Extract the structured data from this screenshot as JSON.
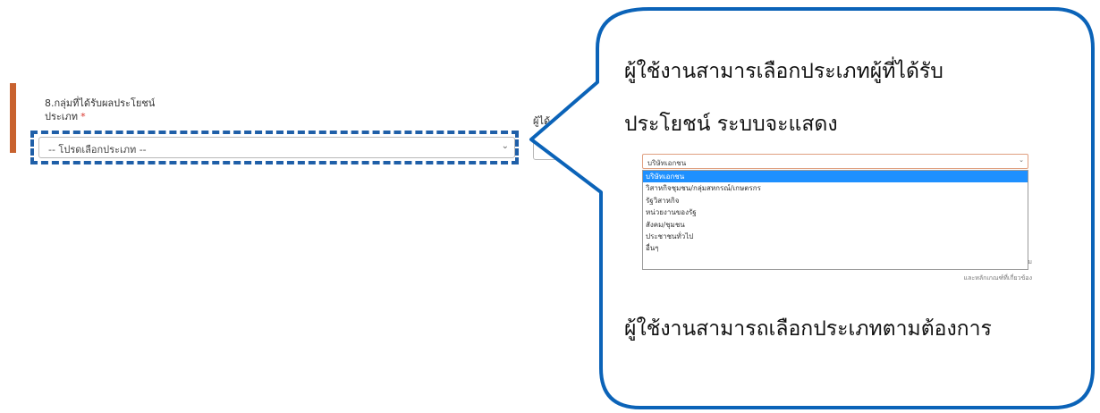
{
  "form": {
    "section_title": "8.กลุ่มที่ได้รับผลประโยชน์",
    "type_label": "ประเภท",
    "required_mark": "*",
    "select_placeholder": "-- โปรดเลือกประเภท --",
    "partial_label": "ผู้ได้"
  },
  "callout": {
    "line1": "ผู้ใช้งานสามารเลือกประเภทผู้ที่ได้รับ",
    "line2": "ประโยชน์ ระบบจะแสดง",
    "line3": "ผู้ใช้งานสามารถเลือกประเภทตามต้องการ"
  },
  "dropdown_preview": {
    "selected_value": "บริษัทเอกชน",
    "options": [
      "บริษัทเอกชน",
      "วิสาหกิจชุมชน/กลุ่มสหกรณ์/เกษตรกร",
      "รัฐวิสาหกิจ",
      "หน่วยงานของรัฐ",
      "สังคม/ชุมชน",
      "ประชาชนทั่วไป",
      "อื่นๆ"
    ],
    "highlighted_index": 0,
    "partial_text_1": "ม",
    "partial_text_2": "และหลักเกณฑ์ที่เกี่ยวข้อง"
  },
  "colors": {
    "accent": "#c8622f",
    "highlight_outline": "#1f5fa8",
    "callout_border": "#0b63b8",
    "option_selected": "#1e90ff"
  }
}
